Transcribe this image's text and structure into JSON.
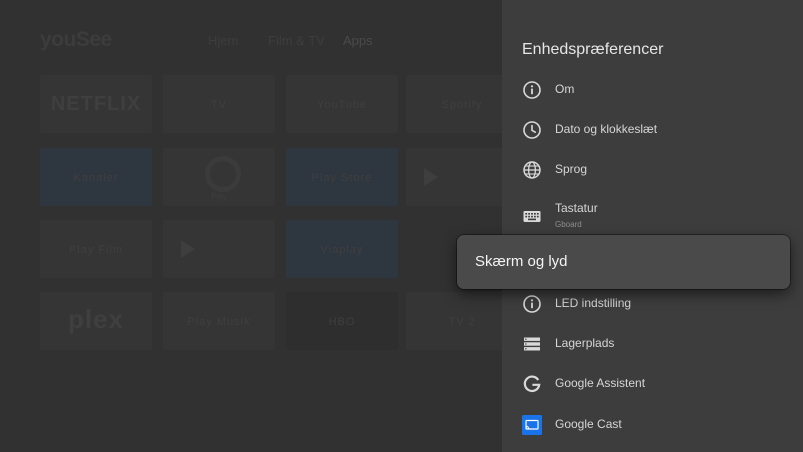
{
  "background": {
    "logo": "youSee",
    "nav": [
      "Hjem",
      "Film & TV",
      "Apps"
    ],
    "tiles": [
      {
        "text": "NETFLIX"
      },
      {
        "text": "TV"
      },
      {
        "text": "YouTube"
      },
      {
        "text": "Spotify"
      },
      {
        "text": "Kanaler"
      },
      {
        "text": "Play"
      },
      {
        "text": "Play Store"
      },
      {
        "text": "Google Play"
      },
      {
        "text": "Play Film"
      },
      {
        "text": "Play Spil"
      },
      {
        "text": "Viaplay"
      },
      {
        "text": "plex"
      },
      {
        "text": "Play Musik"
      },
      {
        "text": "HBO"
      },
      {
        "text": "TV 2"
      }
    ]
  },
  "panel": {
    "title": "Enhedspræferencer",
    "items": [
      {
        "label": "Om",
        "icon": "info-icon"
      },
      {
        "label": "Dato og klokkeslæt",
        "icon": "clock-icon"
      },
      {
        "label": "Sprog",
        "icon": "globe-icon"
      },
      {
        "label": "Tastatur",
        "sublabel": "Gboard",
        "icon": "keyboard-icon"
      },
      {
        "label": "Skærm og lyd",
        "focused": true
      },
      {
        "label": "LED indstilling",
        "icon": "info-icon"
      },
      {
        "label": "Lagerplads",
        "icon": "storage-icon"
      },
      {
        "label": "Google Assistent",
        "icon": "google-icon"
      },
      {
        "label": "Google Cast",
        "icon": "cast-icon"
      }
    ]
  },
  "colors": {
    "panel_bg": "#3d3d3d",
    "focus_card": "#4a4a4a",
    "cast_blue": "#1a73e8"
  }
}
